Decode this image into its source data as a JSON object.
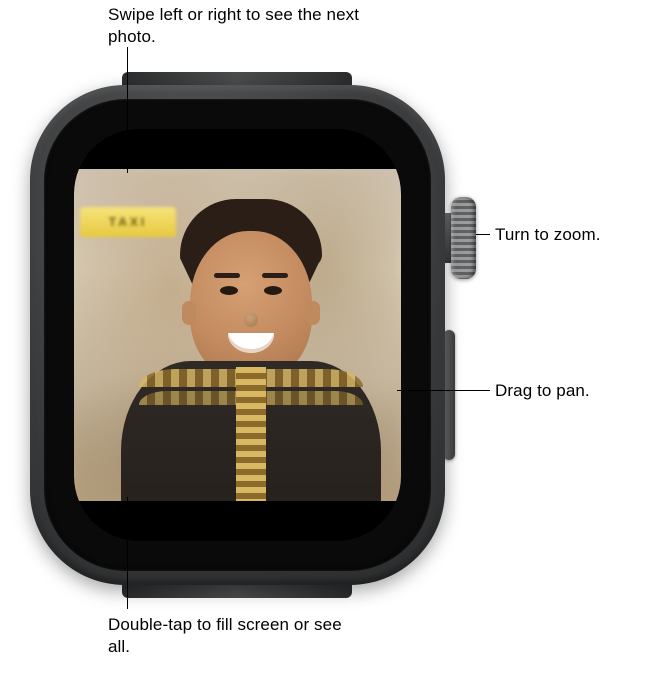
{
  "callouts": {
    "swipe": "Swipe left or right to see the next photo.",
    "crown": "Turn to zoom.",
    "pan": "Drag to pan.",
    "doubletap": "Double-tap to fill screen or see all."
  },
  "photo": {
    "taxi_text": "TAXI"
  }
}
